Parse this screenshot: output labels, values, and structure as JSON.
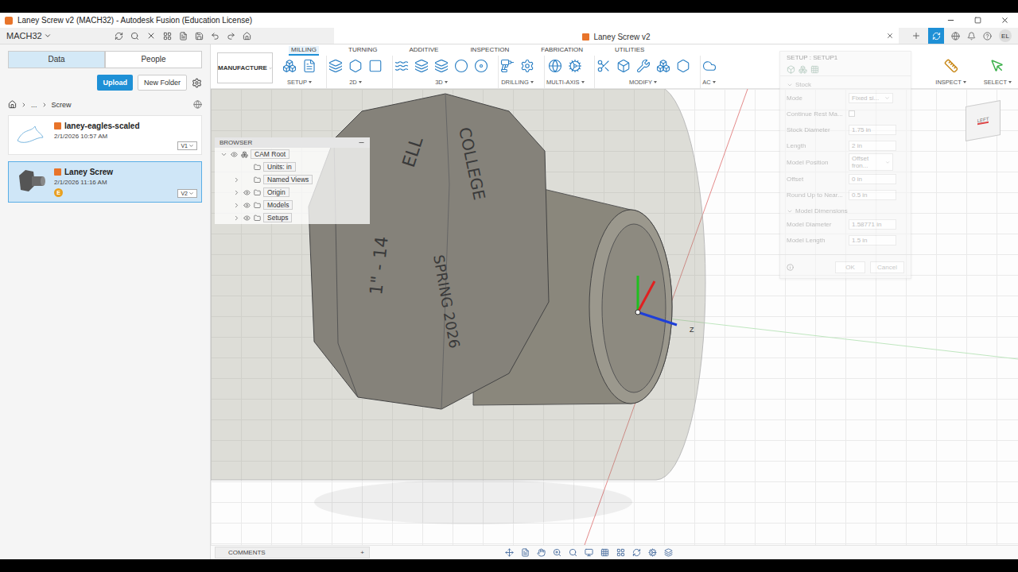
{
  "window": {
    "title": "Laney Screw v2 (MACH32) - Autodesk Fusion (Education License)"
  },
  "topbar": {
    "project": "MACH32",
    "document_tab": "Laney Screw v2",
    "user": "EL"
  },
  "data_panel": {
    "tabs": [
      {
        "label": "Data",
        "selected": true
      },
      {
        "label": "People",
        "selected": false
      }
    ],
    "upload": "Upload",
    "new_folder": "New Folder",
    "breadcrumb": [
      "...",
      "Screw"
    ],
    "files": [
      {
        "name": "laney-eagles-scaled",
        "date": "2/1/2026 10:57 AM",
        "version": "V1",
        "badge": "",
        "selected": false
      },
      {
        "name": "Laney Screw",
        "date": "2/1/2026 11:16 AM",
        "version": "V2",
        "badge": "E",
        "selected": true
      }
    ]
  },
  "toolbar": {
    "workspace": "MANUFACTURE",
    "tabs": [
      {
        "label": "MILLING",
        "selected": true
      },
      {
        "label": "TURNING",
        "selected": false
      },
      {
        "label": "ADDITIVE",
        "selected": false
      },
      {
        "label": "INSPECTION",
        "selected": false
      },
      {
        "label": "FABRICATION",
        "selected": false
      },
      {
        "label": "UTILITIES",
        "selected": false
      }
    ],
    "groups": [
      "SETUP",
      "2D",
      "3D",
      "DRILLING",
      "MULTI-AXIS",
      "MODIFY",
      "AC"
    ],
    "right_groups": [
      "INSPECT",
      "SELECT"
    ]
  },
  "browser": {
    "title": "BROWSER",
    "items": [
      {
        "label": "CAM Root",
        "eye": true,
        "expandable": true,
        "expanded": true,
        "depth": 0
      },
      {
        "label": "Units: in",
        "eye": false,
        "expandable": false,
        "expanded": false,
        "depth": 1
      },
      {
        "label": "Named Views",
        "eye": false,
        "expandable": true,
        "expanded": false,
        "depth": 1
      },
      {
        "label": "Origin",
        "eye": true,
        "expandable": true,
        "expanded": false,
        "depth": 1
      },
      {
        "label": "Models",
        "eye": true,
        "expandable": true,
        "expanded": false,
        "depth": 1
      },
      {
        "label": "Setups",
        "eye": true,
        "expandable": true,
        "expanded": false,
        "depth": 1
      }
    ]
  },
  "dialog": {
    "title": "SETUP : SETUP1",
    "disabled": true,
    "section": "Stock",
    "fields": [
      {
        "label": "Mode",
        "value": "Fixed si...",
        "kind": "select"
      },
      {
        "label": "Continue Rest Ma...",
        "value": "",
        "kind": "checkbox",
        "checked": false
      },
      {
        "label": "Stock Diameter",
        "value": "1.75 in",
        "kind": "input"
      },
      {
        "label": "Length",
        "value": "2 in",
        "kind": "input"
      },
      {
        "label": "Model Position",
        "value": "Offset fron...",
        "kind": "select"
      },
      {
        "label": "Offset",
        "value": "0 in",
        "kind": "input"
      },
      {
        "label": "Round Up to Near...",
        "value": "0.5 in",
        "kind": "input"
      }
    ],
    "section2": "Model Dimensions",
    "fields2": [
      {
        "label": "Model Diameter",
        "value": "1.58771 in",
        "kind": "input"
      },
      {
        "label": "Model Length",
        "value": "1.5 in",
        "kind": "input"
      }
    ],
    "buttons": [
      "OK",
      "Cancel"
    ]
  },
  "model": {
    "engravings": [
      "ELL",
      "1\" - 14",
      "COLLEGE",
      "SPRING 2026"
    ],
    "axis_label": "Z"
  },
  "viewcube": {
    "face": "LEFT"
  },
  "comments": {
    "label": "COMMENTS",
    "add": "+"
  }
}
